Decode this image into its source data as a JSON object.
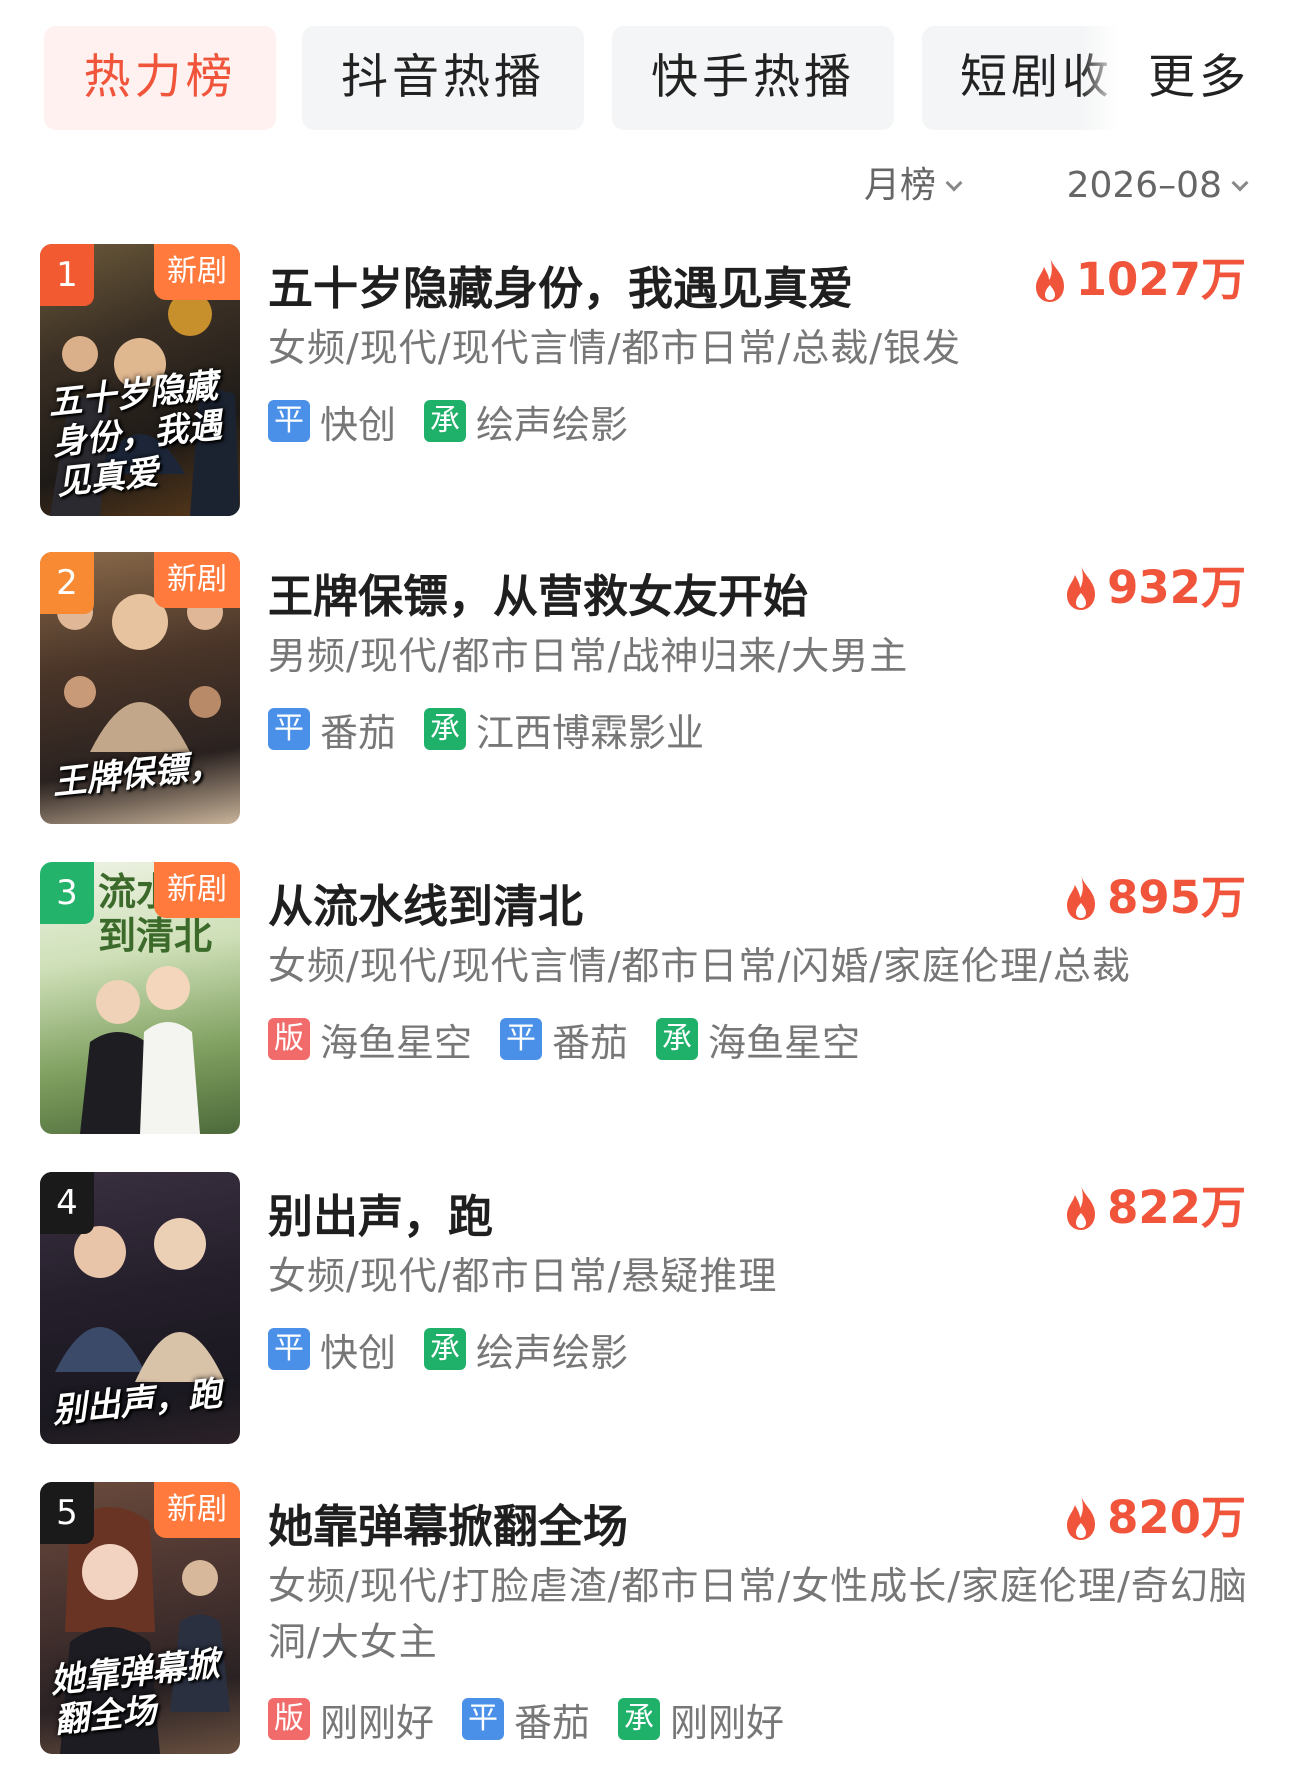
{
  "tabs": [
    {
      "label": "热力榜",
      "active": true
    },
    {
      "label": "抖音热播",
      "active": false
    },
    {
      "label": "快手热播",
      "active": false
    },
    {
      "label": "短剧收",
      "active": false
    }
  ],
  "more_label": "更多",
  "filters": {
    "period": "月榜",
    "date": "2026–08"
  },
  "colors": {
    "accent": "#f0553c",
    "new_badge": "#ff7a3c",
    "chip_ping": "#4a90e8",
    "chip_cheng": "#1fb06a",
    "chip_ban": "#f26b6b"
  },
  "items": [
    {
      "rank": "1",
      "badge": "新剧",
      "title": "五十岁隐藏身份，我遇见真爱",
      "hot": "1027万",
      "tags": "女频/现代/现代言情/都市日常/总裁/银发",
      "poster_text": "五十岁隐藏身份，我遇见真爱",
      "credits": [
        {
          "chip": "平",
          "name": "快创"
        },
        {
          "chip": "承",
          "name": "绘声绘影"
        }
      ]
    },
    {
      "rank": "2",
      "badge": "新剧",
      "title": "王牌保镖，从营救女友开始",
      "hot": "932万",
      "tags": "男频/现代/都市日常/战神归来/大男主",
      "poster_text": "王牌保镖，",
      "credits": [
        {
          "chip": "平",
          "name": "番茄"
        },
        {
          "chip": "承",
          "name": "江西博霖影业"
        }
      ]
    },
    {
      "rank": "3",
      "badge": "新剧",
      "title": "从流水线到清北",
      "hot": "895万",
      "tags": "女频/现代/现代言情/都市日常/闪婚/家庭伦理/总裁",
      "poster_text": "流水线到清北",
      "credits": [
        {
          "chip": "版",
          "name": "海鱼星空"
        },
        {
          "chip": "平",
          "name": "番茄"
        },
        {
          "chip": "承",
          "name": "海鱼星空"
        }
      ]
    },
    {
      "rank": "4",
      "badge": "",
      "title": "别出声，跑",
      "hot": "822万",
      "tags": "女频/现代/都市日常/悬疑推理",
      "poster_text": "别出声，跑",
      "credits": [
        {
          "chip": "平",
          "name": "快创"
        },
        {
          "chip": "承",
          "name": "绘声绘影"
        }
      ]
    },
    {
      "rank": "5",
      "badge": "新剧",
      "title": "她靠弹幕掀翻全场",
      "hot": "820万",
      "tags": "女频/现代/打脸虐渣/都市日常/女性成长/家庭伦理/奇幻脑洞/大女主",
      "poster_text": "她靠弹幕掀翻全场",
      "credits": [
        {
          "chip": "版",
          "name": "刚刚好"
        },
        {
          "chip": "平",
          "name": "番茄"
        },
        {
          "chip": "承",
          "name": "刚刚好"
        }
      ]
    }
  ]
}
